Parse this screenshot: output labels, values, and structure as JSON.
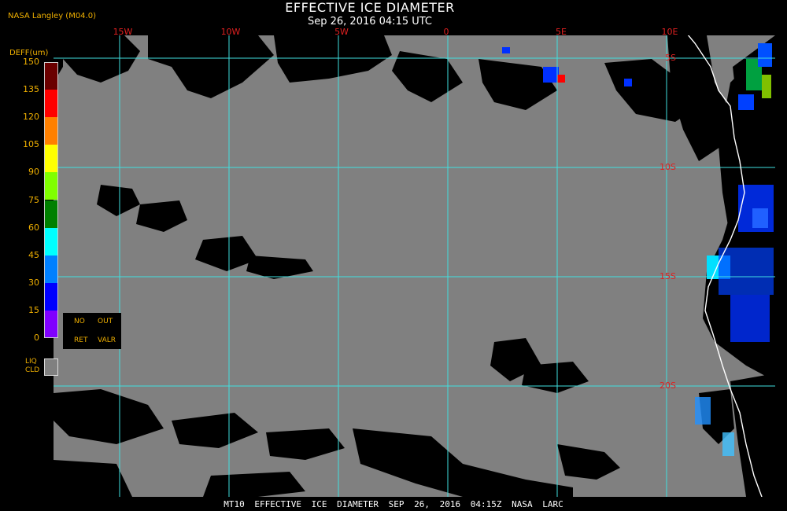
{
  "header": {
    "credit": "NASA Langley (M04.0)",
    "title": "EFFECTIVE ICE DIAMETER",
    "subtitle": "Sep 26, 2016 04:15 UTC"
  },
  "map": {
    "longitude_labels": [
      "15W",
      "10W",
      "5W",
      "0",
      "5E",
      "10E"
    ],
    "latitude_labels": [
      "5S",
      "10S",
      "15S",
      "20S"
    ],
    "gridline_color": "#40e0e0",
    "cloud_color": "#808080",
    "clear_color": "#000000",
    "coastline_color": "#ffffff"
  },
  "colorbar": {
    "title": "DEFF(um)",
    "ticks": [
      "150",
      "135",
      "120",
      "105",
      "90",
      "75",
      "60",
      "45",
      "30",
      "15",
      "0"
    ],
    "colors": [
      "#6a0000",
      "#ff0000",
      "#ff8000",
      "#ffff00",
      "#80ff00",
      "#008000",
      "#00ffff",
      "#0080ff",
      "#0000ff",
      "#8000ff"
    ],
    "no_retrieval": {
      "line1_left": "NO",
      "line1_right": "OUT",
      "line2_left": "RET",
      "line2_right": "VALR"
    },
    "liquid_cloud": {
      "line1": "LIQ",
      "line2": "CLD"
    }
  },
  "footer": {
    "text": "MT10 EFFECTIVE ICE DIAMETER SEP 26, 2016 04:15Z NASA LARC"
  }
}
